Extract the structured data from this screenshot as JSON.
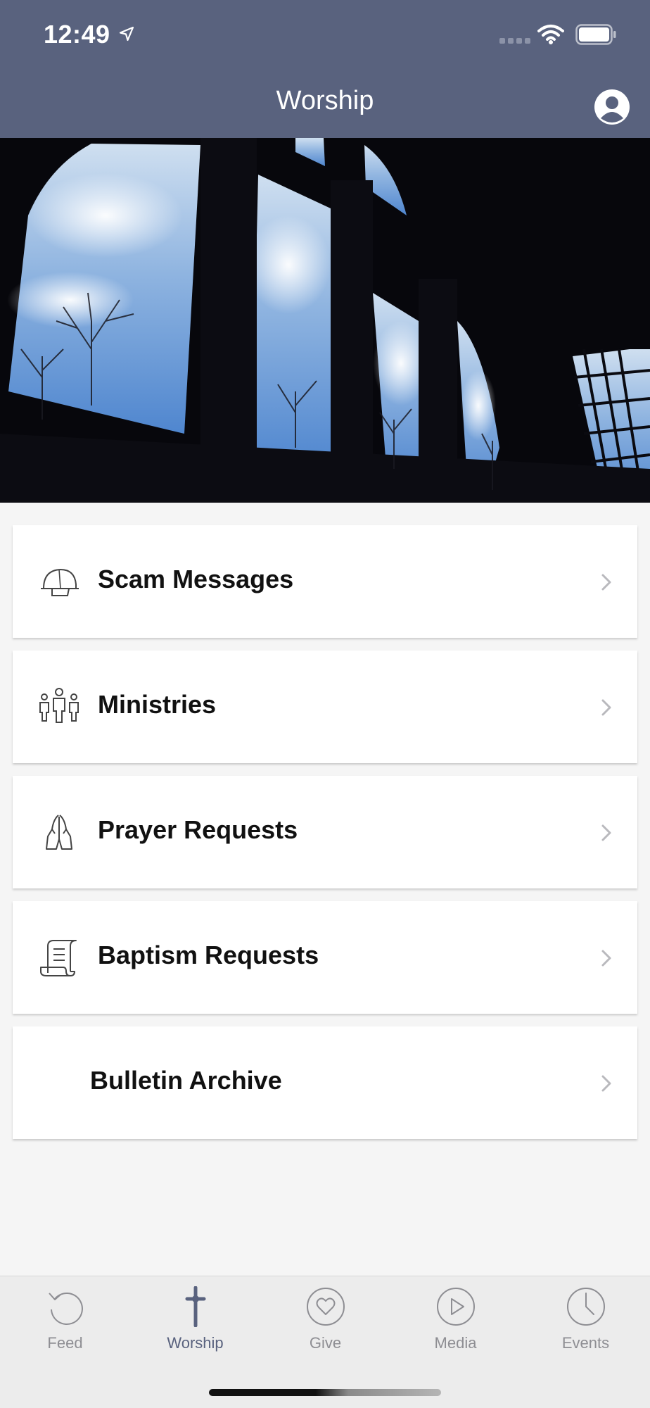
{
  "status_bar": {
    "time": "12:49",
    "icons": [
      "location-arrow-icon",
      "cellular-signal-icon",
      "wifi-icon",
      "battery-icon"
    ]
  },
  "nav": {
    "title": "Worship",
    "account_icon": "user-circle-icon"
  },
  "hero": {
    "image": "church-windows-sky-photo"
  },
  "menu": {
    "items": [
      {
        "label": "Scam Messages",
        "icon": "helmet-icon"
      },
      {
        "label": "Ministries",
        "icon": "people-group-icon"
      },
      {
        "label": "Prayer Requests",
        "icon": "praying-hands-icon"
      },
      {
        "label": "Baptism Requests",
        "icon": "scroll-icon"
      },
      {
        "label": "Bulletin Archive",
        "icon": ""
      }
    ],
    "chevron_icon": "chevron-right-icon"
  },
  "tabs": [
    {
      "label": "Feed",
      "icon": "refresh-icon",
      "active": false
    },
    {
      "label": "Worship",
      "icon": "cross-icon",
      "active": true
    },
    {
      "label": "Give",
      "icon": "heart-icon",
      "active": false
    },
    {
      "label": "Media",
      "icon": "play-icon",
      "active": false
    },
    {
      "label": "Events",
      "icon": "clock-icon",
      "active": false
    }
  ],
  "colors": {
    "header": "#59627e",
    "active_tab": "#59627e",
    "inactive_tab": "#8e8e93",
    "background": "#f5f5f5"
  }
}
